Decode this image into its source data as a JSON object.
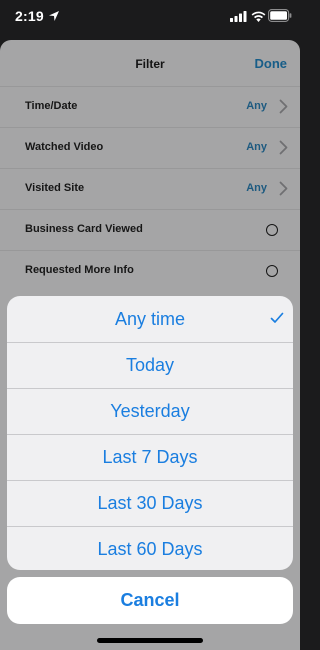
{
  "status_bar": {
    "time": "2:19"
  },
  "filter": {
    "title": "Filter",
    "done_label": "Done",
    "rows": [
      {
        "label": "Time/Date",
        "value": "Any"
      },
      {
        "label": "Watched Video",
        "value": "Any"
      },
      {
        "label": "Visited Site",
        "value": "Any"
      },
      {
        "label": "Business Card Viewed"
      },
      {
        "label": "Requested More Info"
      }
    ]
  },
  "action_sheet": {
    "options": [
      "Any time",
      "Today",
      "Yesterday",
      "Last 7 Days",
      "Last 30 Days",
      "Last 60 Days"
    ],
    "selected": "Any time",
    "cancel_label": "Cancel"
  },
  "colors": {
    "accent": "#1a7ee0",
    "sheet_dimmed": "#a5a5a6",
    "done": "#175d88"
  },
  "icons": [
    "location-arrow-icon",
    "signal-icon",
    "wifi-icon",
    "battery-icon",
    "chevron-right-icon",
    "radio-circle-icon",
    "checkmark-icon"
  ]
}
